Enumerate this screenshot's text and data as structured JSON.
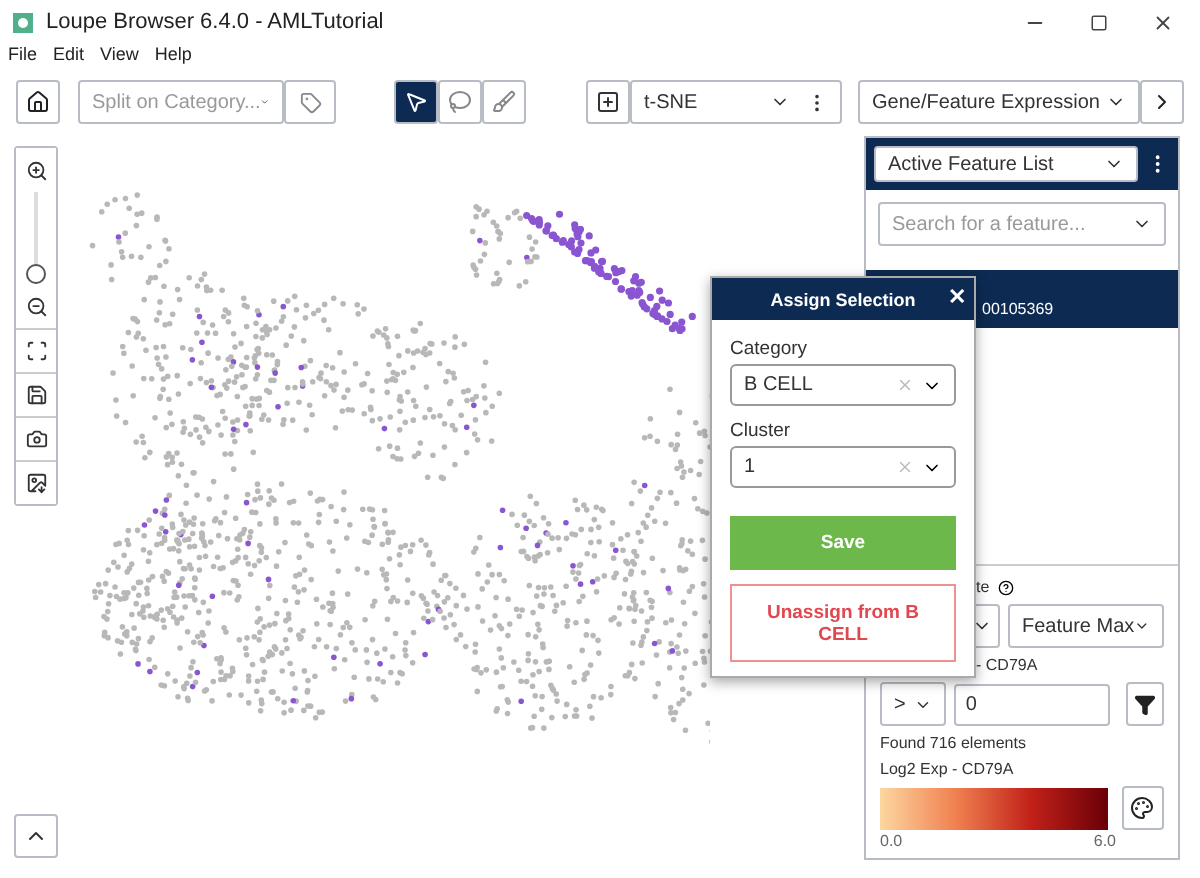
{
  "window": {
    "title": "Loupe Browser 6.4.0 - AMLTutorial"
  },
  "menu": [
    "File",
    "Edit",
    "View",
    "Help"
  ],
  "toolbar": {
    "split": {
      "placeholder": "Split on Category..."
    },
    "tools": [
      {
        "kind": "pointer",
        "selected": true
      },
      {
        "kind": "lasso",
        "selected": false
      },
      {
        "kind": "brush",
        "selected": false
      }
    ],
    "projection": "t-SNE",
    "view": "Gene/Feature Expression"
  },
  "zoom": {
    "level": 0
  },
  "panel": {
    "list": "Active Feature List",
    "search": {
      "placeholder": "Search for a feature..."
    },
    "feature_id": "00105369",
    "scale_label": "te",
    "scale": "Feature Max",
    "filter_label": "- CD79A",
    "operator": ">",
    "threshold": "0",
    "found": "Found 716 elements",
    "legend": {
      "title": "Log2 Exp - CD79A",
      "min": "0.0",
      "max": "6.0"
    }
  },
  "dialog": {
    "title": "Assign Selection",
    "close": "✕",
    "fields": [
      {
        "label": "Category",
        "value": "B CELL"
      },
      {
        "label": "Cluster",
        "value": "1"
      }
    ],
    "save": "Save",
    "unassign": "Unassign from B CELL"
  }
}
